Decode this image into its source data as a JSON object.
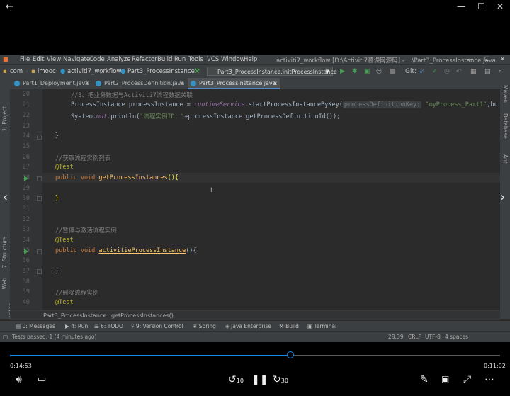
{
  "window": {
    "minimize": "—",
    "maximize": "☐",
    "close": "✕"
  },
  "ide": {
    "menu": [
      "File",
      "Edit",
      "View",
      "Navigate",
      "Code",
      "Analyze",
      "Refactor",
      "Build",
      "Run",
      "Tools",
      "VCS",
      "Window",
      "Help"
    ],
    "title": "activiti7_workflow [D:\\Activiti7慕课网源码] - ...\\Part3_ProcessInstance.java",
    "breadcrumbs": [
      "com",
      "imooc",
      "activiti7_workflow",
      "Part3_ProcessInstance"
    ],
    "run_config": "Part3_ProcessInstance.initProcessInstance",
    "git_label": "Git:",
    "tabs": [
      "Part1_Deployment.java",
      "Part2_ProcessDefinition.java",
      "Part3_ProcessInstance.java"
    ],
    "active_tab": 2,
    "left_tools": [
      "1: Project",
      "7: Structure",
      "Web",
      "2: Favorites"
    ],
    "right_tools": [
      "Maven",
      "Database",
      "Ant"
    ],
    "line_numbers": [
      "20",
      "21",
      "22",
      "23",
      "24",
      "25",
      "26",
      "27",
      "28",
      "29",
      "30",
      "31",
      "32",
      "33",
      "34",
      "35",
      "36",
      "37",
      "38",
      "39",
      "40"
    ],
    "code": {
      "l20_comment": "//3、把业务数据与Activiti7流程数据关联",
      "l21_type": "ProcessInstance processInstance = ",
      "l21_field": "runtimeService",
      "l21_call": ".startProcessInstanceByKey(",
      "l21_hint": "processDefinitionKey:",
      "l21_str": "\"myProcess_Part1\"",
      "l21_rest": ",bu",
      "l22_a": "System.",
      "l22_field": "out",
      "l22_b": ".println(",
      "l22_str": "\"流程实例ID：\"",
      "l22_c": "+processInstance.getProcessDefinitionId());",
      "l24": "}",
      "l26_comment": "//获取流程实例列表",
      "l27_annot": "@Test",
      "l28_kw": "public void ",
      "l28_fn": "getProcessInstances",
      "l28_rest": "(){",
      "l30": "}",
      "l33_comment": "//暂停与激活流程实例",
      "l34_annot": "@Test",
      "l35_kw": "public void ",
      "l35_fn": "activitieProcessInstance",
      "l35_rest": "(){",
      "l37": "}",
      "l39_comment": "//删除流程实例",
      "l40_annot": "@Test"
    },
    "editor_breadcrumb": [
      "Part3_ProcessInstance",
      "getProcessInstances()"
    ],
    "tool_windows": [
      "0: Messages",
      "4: Run",
      "6: TODO",
      "9: Version Control",
      "Spring",
      "Java Enterprise",
      "Build",
      "Terminal"
    ],
    "status_left": "Tests passed: 1 (4 minutes ago)",
    "status_right": [
      "28:39",
      "CRLF",
      "UTF-8",
      "4 spaces"
    ]
  },
  "player": {
    "current_time": "0:14:53",
    "total_time": "0:11:02",
    "progress": 0.572,
    "skip_back": "10",
    "skip_forward": "30"
  }
}
